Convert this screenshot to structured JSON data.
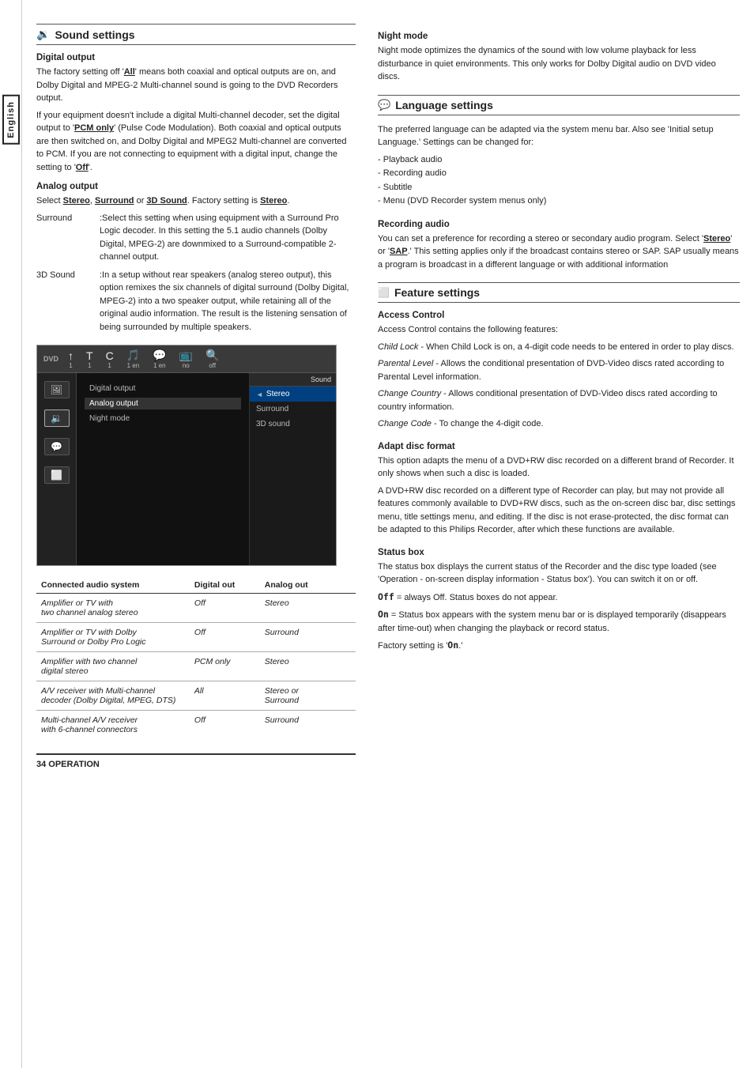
{
  "side_tab": {
    "label": "English"
  },
  "left": {
    "sound_settings": {
      "title": "Sound settings",
      "icon": "🔉",
      "digital_output": {
        "title": "Digital output",
        "para1": "The factory setting off 'All' means both coaxial and optical outputs are on, and Dolby Digital and MPEG-2 Multi-channel sound is going to the DVD Recorders output.",
        "para2": "If your equipment doesn't include a digital Multi-channel decoder, set the digital output to 'PCM only' (Pulse Code Modulation). Both coaxial and optical outputs are then switched on, and Dolby Digital and MPEG2 Multi-channel are converted to PCM. If you are not connecting to equipment with a digital input, change the setting to 'Off'."
      },
      "analog_output": {
        "title": "Analog output",
        "select_line": "Select Stereo, Surround or 3D Sound. Factory setting is Stereo.",
        "items": [
          {
            "label": "Surround",
            "description": ":Select this setting when using equipment with a Surround Pro Logic decoder. In this setting the 5.1 audio channels (Dolby Digital, MPEG-2) are downmixed to a Surround-compatible 2-channel output."
          },
          {
            "label": "3D Sound",
            "description": ":In a setup without rear speakers (analog stereo output), this option remixes the six channels of digital surround (Dolby Digital, MPEG-2) into a two speaker output, while retaining all of the original audio information. The result is the listening sensation of being surrounded by multiple speakers."
          }
        ]
      },
      "menu": {
        "top_items": [
          "1↑",
          "T",
          "C",
          "🔊",
          "□",
          "📺",
          "🔍"
        ],
        "top_values": [
          "1",
          "1",
          "1 en",
          "1 en",
          "no",
          "off"
        ],
        "left_icons": [
          "🖼️",
          "🔉",
          "💬",
          "🔲"
        ],
        "center_items": [
          "Digital output",
          "Analog output",
          "Night mode"
        ],
        "selected_center": "Analog output",
        "right_header": "Sound",
        "right_items": [
          {
            "label": "Stereo",
            "selected": true,
            "check": true
          },
          {
            "label": "Surround",
            "selected": false,
            "check": false
          },
          {
            "label": "3D sound",
            "selected": false,
            "check": false
          }
        ]
      },
      "table": {
        "headers": [
          "Connected audio system",
          "Digital out",
          "Analog out"
        ],
        "rows": [
          {
            "device": "Amplifier or TV with\ntwo channel analog stereo",
            "digital": "Off",
            "analog": "Stereo"
          },
          {
            "device": "Amplifier or TV with Dolby\nSurround or Dolby Pro Logic",
            "digital": "Off",
            "analog": "Surround"
          },
          {
            "device": "Amplifier with two channel\ndigital stereo",
            "digital": "PCM only",
            "analog": "Stereo"
          },
          {
            "device": "A/V receiver with Multi-channel\ndecoder (Dolby Digital, MPEG, DTS)",
            "digital": "All",
            "analog": "Stereo or\nSurround"
          },
          {
            "device": "Multi-channel A/V receiver\nwith 6-channel connectors",
            "digital": "Off",
            "analog": "Surround"
          }
        ]
      }
    }
  },
  "right": {
    "night_mode": {
      "title": "Night mode",
      "text": "Night mode optimizes the dynamics of the sound with low volume playback for less disturbance in quiet environments. This only works for Dolby Digital audio on DVD video discs."
    },
    "language_settings": {
      "title": "Language settings",
      "icon": "💬",
      "intro": "The preferred language can be adapted via the system menu bar.  Also see 'Initial setup Language.' Settings can be changed for:",
      "items": [
        "Playback audio",
        "Recording audio",
        "Subtitle",
        "Menu (DVD Recorder system menus only)"
      ],
      "recording_audio": {
        "title": "Recording audio",
        "text1": "You can set a preference for recording a stereo or secondary audio program. Select 'Stereo' or 'SAP.' This setting applies only if the broadcast contains stereo or SAP. SAP usually means a program is broadcast in a different language or with additional information"
      }
    },
    "feature_settings": {
      "title": "Feature settings",
      "icon": "⏹",
      "access_control": {
        "title": "Access Control",
        "text1": "Access Control contains the following features:",
        "child_lock": "Child Lock - When Child Lock is on, a 4-digit code needs to be entered in order to play discs.",
        "parental_level": "Parental Level - Allows the conditional presentation of DVD-Video discs rated according to Parental Level information.",
        "change_country": "Change Country - Allows conditional presentation of DVD-Video discs rated according to country information.",
        "change_code": "Change Code - To change the 4-digit code."
      },
      "adapt_disc_format": {
        "title": "Adapt disc format",
        "text": "This option adapts the menu of a DVD+RW disc recorded on a different brand of Recorder. It only shows when such a disc is loaded.\nA DVD+RW disc recorded on a different type of Recorder can play, but may not provide all features commonly available to DVD+RW discs, such as the on-screen disc bar, disc settings menu, title settings menu, and editing. If the disc is not erase-protected, the disc format can be adapted to this Philips Recorder, after which these functions are available."
      },
      "status_box": {
        "title": "Status box",
        "text1": "The status box displays the current status of the Recorder and the disc type loaded (see 'Operation - on-screen display information - Status box'). You can switch it on or off.",
        "off_text": "Off = always Off. Status boxes do not appear.",
        "on_text1": "On  = Status box appears with the system menu bar or is displayed temporarily (disappears after time-out) when changing the playback or record status.",
        "factory_text": "Factory setting is 'On.'"
      }
    }
  },
  "footer": {
    "label": "34 OPERATION"
  }
}
